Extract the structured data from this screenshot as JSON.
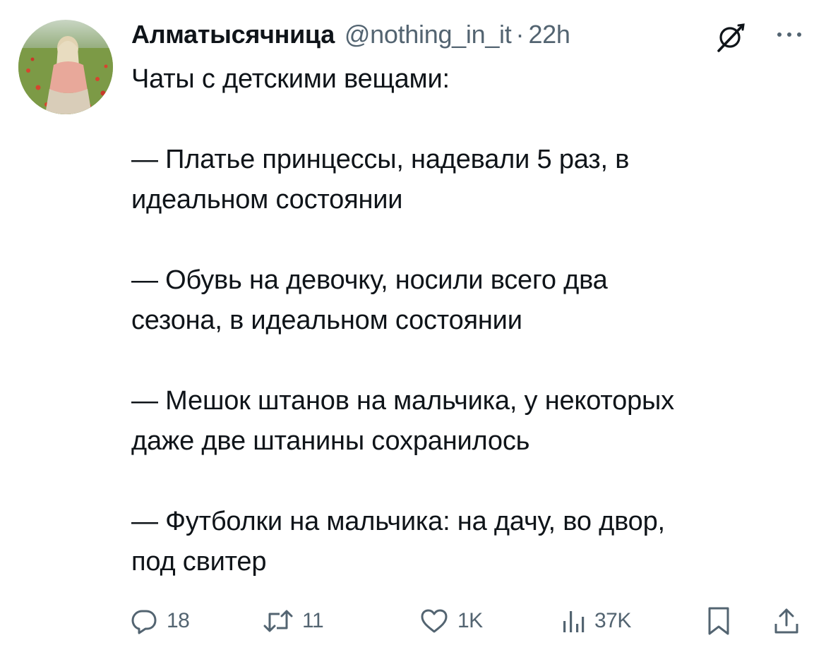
{
  "user": {
    "display_name": "Алматысячница",
    "handle": "@nothing_in_it",
    "separator": "·",
    "time": "22h"
  },
  "tweet": {
    "lines": [
      "Чаты с детскими вещами:",
      "",
      "— Платье принцессы, надевали 5 раз, в",
      "идеальном состоянии",
      "",
      "— Обувь на девочку, носили всего два",
      "сезона, в идеальном состоянии",
      "",
      "— Мешок штанов на мальчика, у некоторых",
      "даже две штанины сохранилось",
      "",
      "— Футболки на мальчика: на дачу, во двор,",
      "под свитер"
    ]
  },
  "actions": {
    "reply": {
      "icon": "reply-icon",
      "count": "18"
    },
    "retweet": {
      "icon": "retweet-icon",
      "count": "11"
    },
    "like": {
      "icon": "heart-icon",
      "count": "1K"
    },
    "views": {
      "icon": "views-icon",
      "count": "37K"
    },
    "bookmark": {
      "icon": "bookmark-icon"
    },
    "share": {
      "icon": "share-icon"
    }
  },
  "colors": {
    "text": "#0f1419",
    "secondary": "#536471",
    "background": "#ffffff"
  }
}
